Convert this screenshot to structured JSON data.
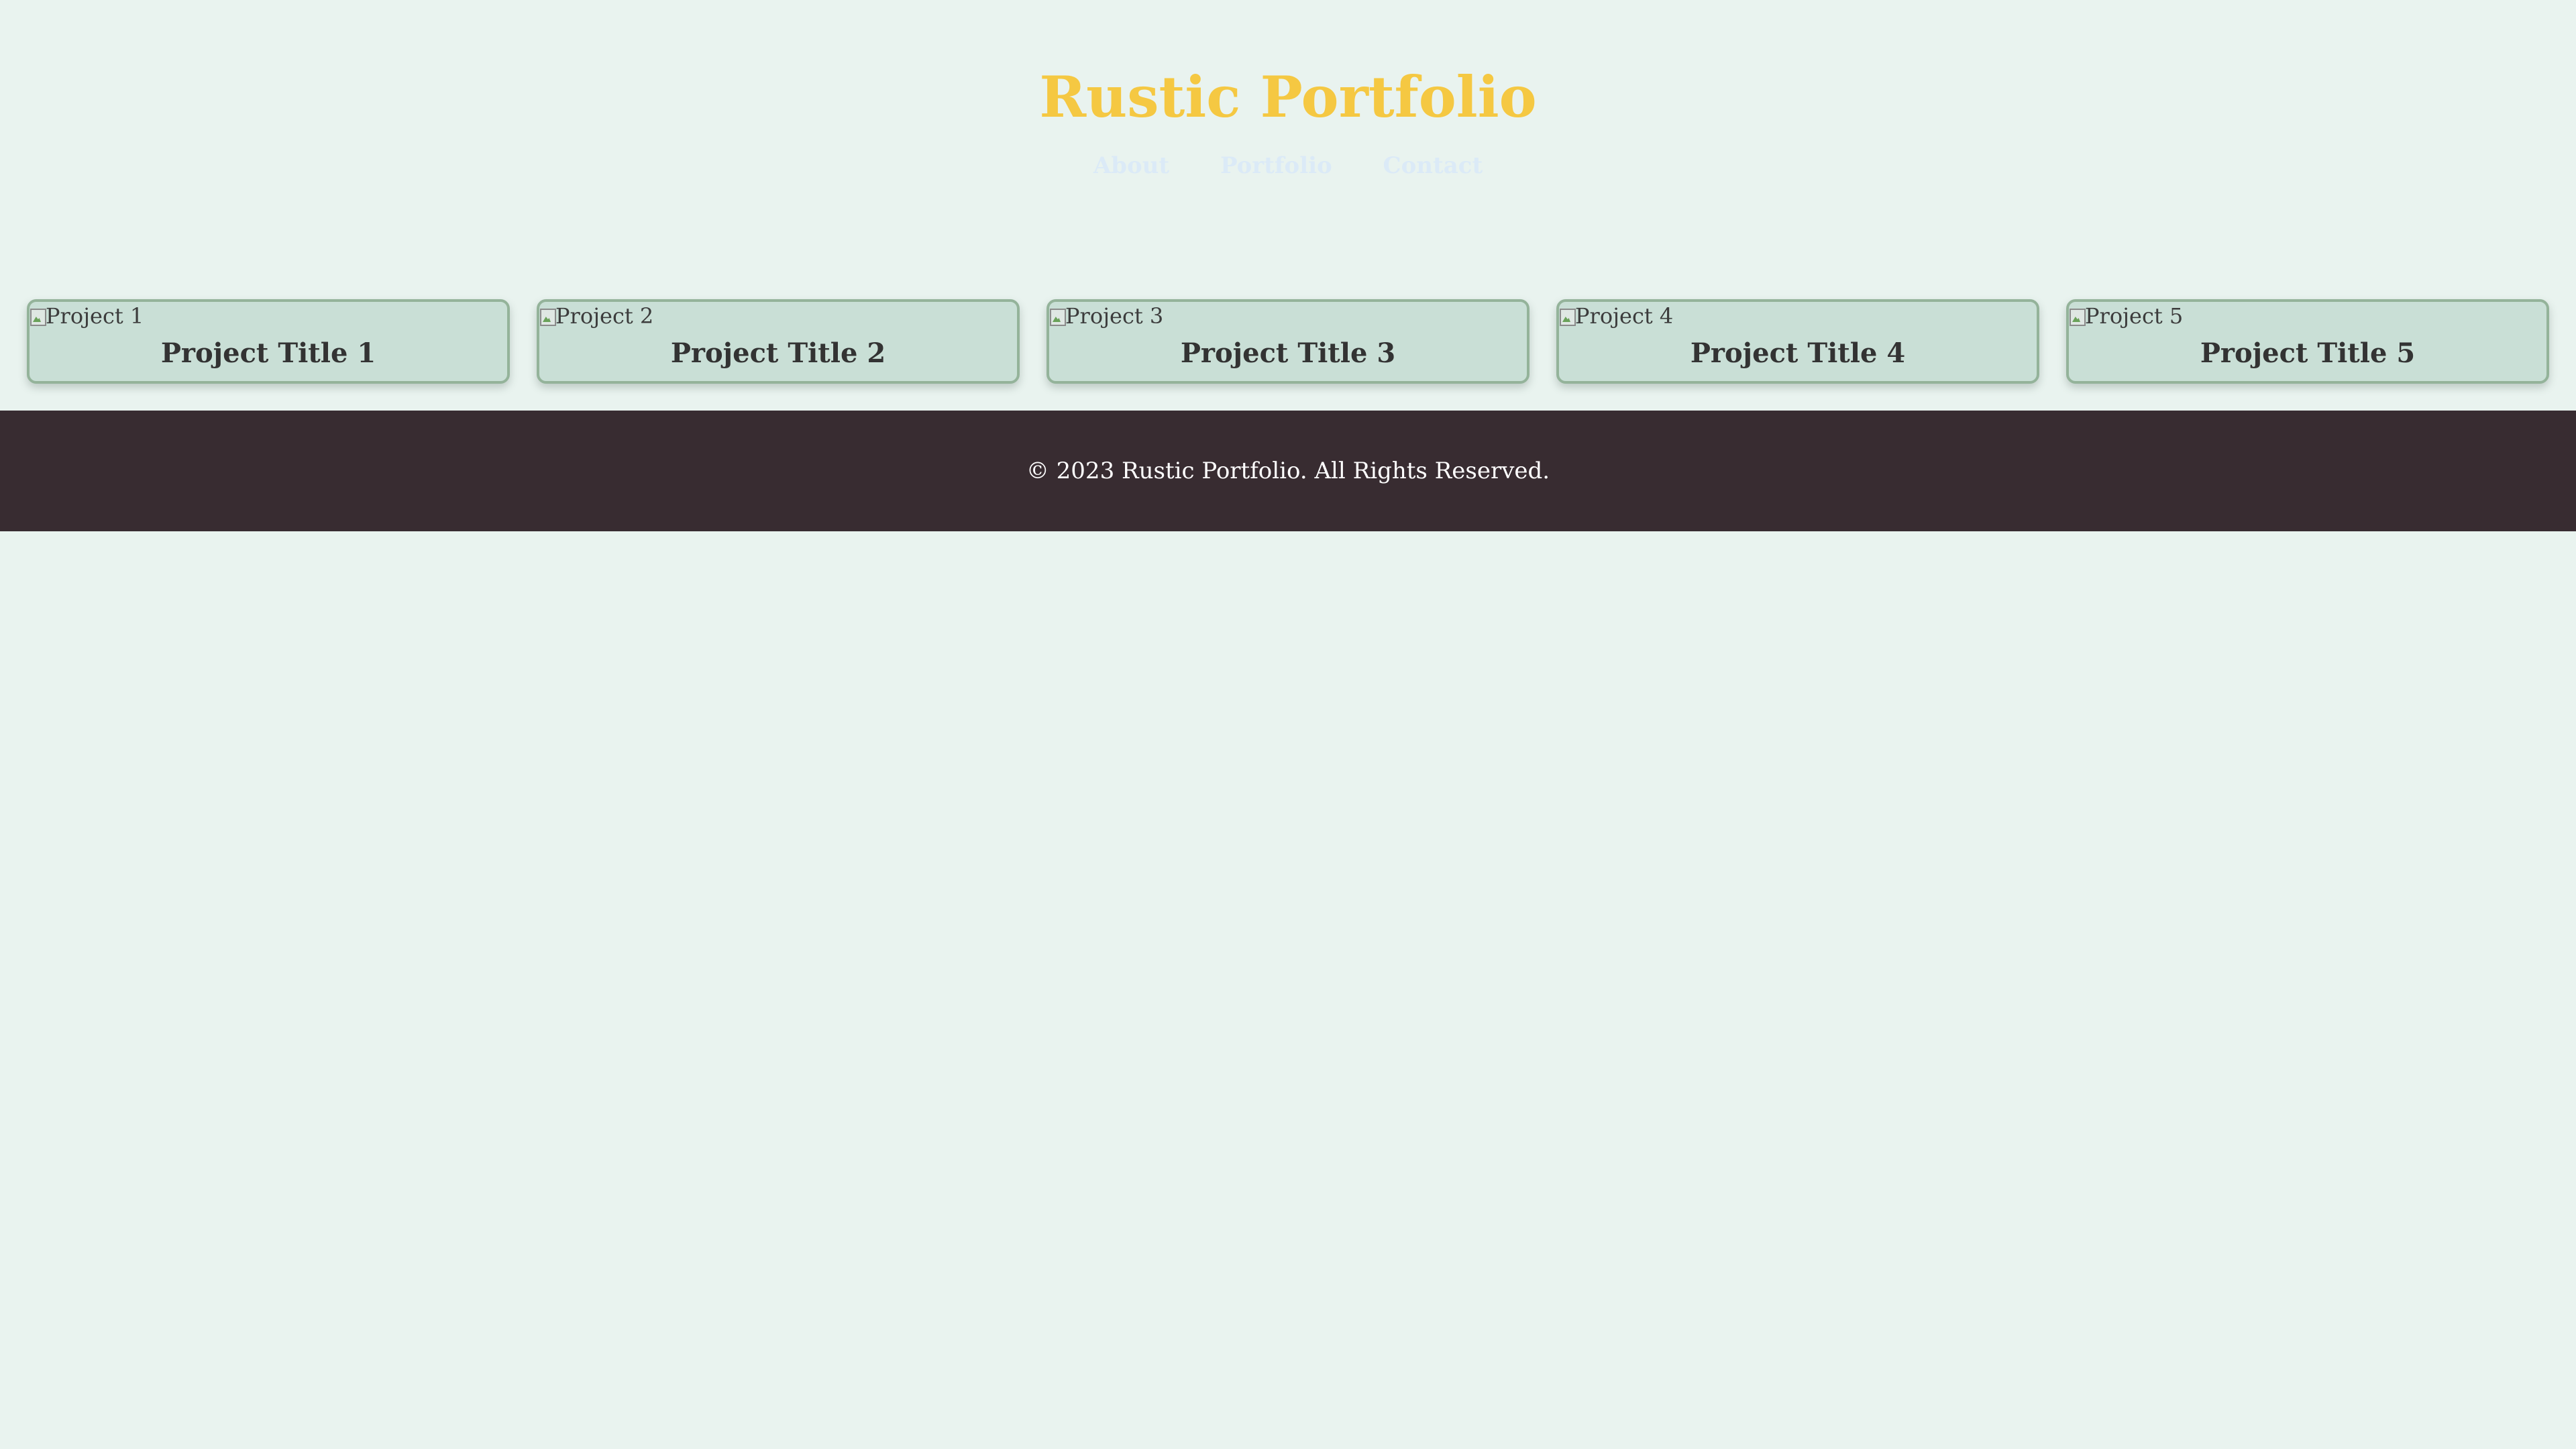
{
  "site": {
    "title": "Rustic Portfolio"
  },
  "nav": {
    "items": [
      {
        "label": "About"
      },
      {
        "label": "Portfolio"
      },
      {
        "label": "Contact"
      }
    ]
  },
  "projects": [
    {
      "image_alt": "Project 1",
      "title": "Project Title 1"
    },
    {
      "image_alt": "Project 2",
      "title": "Project Title 2"
    },
    {
      "image_alt": "Project 3",
      "title": "Project Title 3"
    },
    {
      "image_alt": "Project 4",
      "title": "Project Title 4"
    },
    {
      "image_alt": "Project 5",
      "title": "Project Title 5"
    }
  ],
  "footer": {
    "text": "© 2023 Rustic Portfolio. All Rights Reserved."
  },
  "colors": {
    "background": "#e9f3ef",
    "title_accent": "#f5c842",
    "nav_link": "#dbeaf7",
    "card_background": "#c9dfd6",
    "card_border": "#94b39a",
    "footer_background": "#382c31",
    "footer_text": "#ffffff"
  }
}
